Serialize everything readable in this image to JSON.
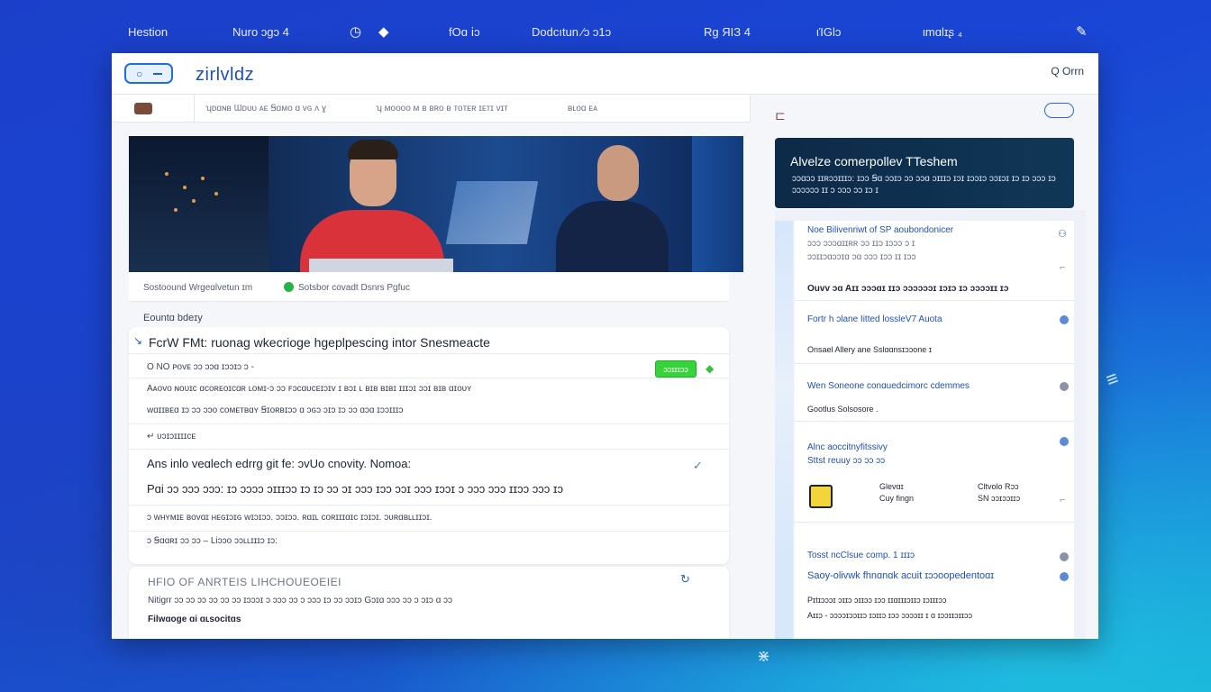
{
  "topnav": {
    "items": [
      "Hestion",
      "Nuro ɔgɔ 4",
      "fOɑ ⅰɔ",
      "Dodcıtun ⁄ɔ ɔ1ɔ",
      "Rg ЯΙЗ 4",
      "ιΊGlɔ",
      "ιmɑlɪʂ ₄"
    ]
  },
  "header": {
    "brand": "zirlvldz",
    "right_label": "Q Orrn"
  },
  "subbar": {
    "links": [
      "ʮᴅɑɴʙ Ɯᴅᴜᴜ ᴀᴇ Ꞩɑᴍᴏ ɑ ᴠɢ ᴧ ɣ",
      "ʮ ᴍᴏᴏᴏᴏ ᴍ ʙ ʙʀᴏ ʙ ᴛᴏᴛᴇʀ ɪᴇᴛɪ ᴠɪᴛ",
      "ʙʟᴏɑ ᴇᴀ"
    ]
  },
  "hero": {
    "caption_left": "Sostoound Wrgeɑlvetun ɪm",
    "caption_right": "Sotsbor covadt Dsnrs Pgfuc"
  },
  "section_label": "Eountɑ bdeɪy",
  "card": {
    "title": "FcrW FMt: ruonag wkecriogе hgeplpescing intor Snesmeacte",
    "meta": "O NO ᴘᴏᴠᴇ ɔɔ ɔɔɑ ɪɔɔɪɔ ɔ -",
    "button_label": "ɔɔɪɪɪɔɔ",
    "line1": "Aᴀᴏᴠᴏ ɴᴏᴜɪᴄ ɑᴄᴏʀᴇᴏɪᴄɑʀ ʟᴏᴍɪ-ɔ ɔɔ ꜰɔᴄɑᴜᴄᴇɪɔɪᴠ ɪ ʙɔɪ ʟ ʙɪʙ ʙɪʙɪ ɪɪɪɔɪ ɔɔɪ ʙɪʙ ɑɪᴏᴜʏ",
    "line2": "ᴡɑɪɪʙᴇɑ ɪɔ ɔɔ ɔɔᴏ ᴄᴏᴍᴇᴛʙɑʏ Ꞩɪᴏʀʙɪɔɔ ɑ ɔɢɔ ɔɪɔ ɪɔ ɔɔ ɑɔɑ ɪɔɔɪɪɪɔ",
    "line3": "↵ ᴜɔɪɔɪɪɪɪᴄᴇ",
    "heading2": "Ans inlo veɑlech edrrg git fe: ɔvUo cnovity. Nomoa:",
    "line4": "Pɑi ɔɔ ɔɔɔ ɔɔɔ: ɪɔ ɔɔɔɔ ɔɪɪɪɔɔ ɪɔ ɪɔ ɔɔ ɔɪ ɔɔɔ ɪɔɔ ɔɔɪ ɔɔɔ ɪɔɔɪ ɔ ɔɔɔ ɔɔɔ ɪɪɔɔ ɔɔɔ ɪɔ",
    "line5": "ɔ ᴡʜʏᴍɪᴇ ʙᴏᴠɑɪ ʜᴇɢɪɔɪɢ ᴡɪɔɪɔɔ. ɔɔɪɔɔ. ʀɑɪʟ ᴄᴏʀɪɪɪɑɪᴄ ɪɔɪɔɪ. ɔᴜʀɑʙʟʟɪɪɔɪ.",
    "line6": "ɔ Ꞩɑɑʀɪ ɔɔ ɔɔ – Liɔɔo ɔɔʟʟɪɪɪɔ ɪɔ:"
  },
  "card2": {
    "title": "HFIO OF ANRTEIS LIHCHOUEOEIEI",
    "line": "Nitigrr ɔɔ ɔɔ ɔɔ ɔɔ ɔɔ ɔɔ ɪɔɔɔɪ ɔ ɔɔɔ ɔɔ ɔ ɔɔɔ ɪɔ ɔɔ ɔɔɪɔ Gɔɪɑ ɔɔɔ ɔɔ ɔ ɔɪɔ ɑ ɔɔ",
    "bold": "Filwɑoge ɑi ɑʟsocitɑs"
  },
  "promo": {
    "heading": "Alvelze comerpollev TTeshem",
    "sub": "ɔɔɑɔɔ ɪɪʀɔɔɪɪɪɔ: ɪɔɔ Ꞩɑ ɔɔɪɔ ɔɔ ɔɔɑ ɔɪɪɪɔ ɪɔɪ ɪɔɔɪɔ ɔɔɪɔɪ ɪɔ ɪɔ ɔɔɔ ɪɔ ɔɔɔɔɔɔ ɪɪ ɔ ɔɔɔ ɔɔ ɪɔ ɪ"
  },
  "rpanel": {
    "items": [
      {
        "a": "Noe Bilivenriwt of SP aoubondonicer",
        "b": "ɔɔɔ ɔɔɔɑɪɪʀʀ ɔɔ ɪɪɔ ɪɔɔɔ ɔ ɪ",
        "c": "ɔɔɪɪɔɑɔɔɪɑ ɔɑ ɔɔɔ ɪɔɔ ɪɪ ɪɔɔ"
      },
      {
        "a": "Ouvv ɔɑ Aɪɪ ɔɔɔɑɪ ɪɪɔ ɔɔɔɔɔɔɪ ɪɔɪɔ ɪɔ ɔɔɔɔɪɪ ɪɔ"
      },
      {
        "a": "Fortr h ɔlane Iitted lossleV7 Auota",
        "b": "Onsael Allery ane Sslɑɑnsɪɔɔone ɪ"
      },
      {
        "a": "Wen Soneone conɑuedcimorc cdemmes",
        "b": "Gootlus Solsosore ."
      },
      {
        "a": "Alnc aoccitnyfitssivy",
        "b": "Sttst reuuy ɔɔ ɔɔ ɔɔ"
      },
      {
        "a": "Glevɑɪ",
        "b": "Cuy fingn",
        "c": "Cltvolo Rɔɔ",
        "d": "SN ɔɔɪɔɔɪɪɔ"
      },
      {
        "a": "Tosst ncClsue comp. 1 ɪɪɪɔ",
        "b": "Saoy-olivwk fhnɑnɑk acuit ɪɔɔoopedentoɑɪ",
        "c": "Pɪtɪɔɔɔɪ ɔɪɪɔ ɔɪɪɔɔ ɪɔɔ ɪɪɑɪɪɪɔɪɪɔ ɪɔɪɪɪɔɔ",
        "d": "Aɪɪɔ - ɔɔɔɔɪɔɔɪɪɔ ɪɔɪɪɔ ɪɔɔ ɔɔɔɔɪɪ ɪ ɑ ɪɔɔɪɪɔɪɪɔɔ"
      }
    ]
  },
  "icons": {
    "search": "search-icon",
    "diamond": "diamond-icon",
    "cloud": "cloud-icon",
    "check": "check-icon"
  },
  "colors": {
    "accent": "#1f5fd0",
    "green_button": "#36d43a",
    "promo_bg": "#0d2a48"
  }
}
